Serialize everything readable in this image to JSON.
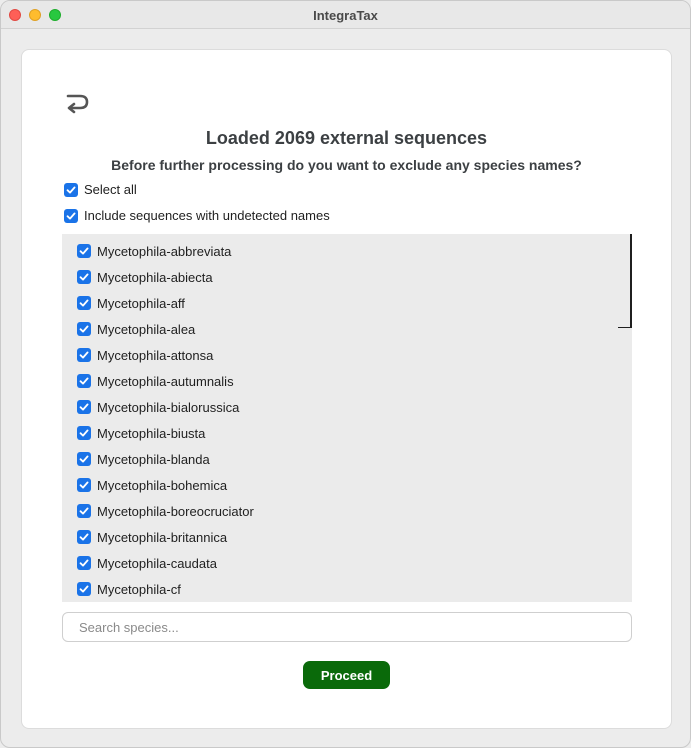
{
  "window": {
    "title": "IntegraTax"
  },
  "header": {
    "heading": "Loaded 2069 external sequences",
    "subheading": "Before further processing do you want to exclude any species names?"
  },
  "options": {
    "select_all": {
      "label": "Select all",
      "checked": true
    },
    "include_undetected": {
      "label": "Include sequences with undetected names",
      "checked": true
    }
  },
  "species": [
    {
      "label": "Mycetophila-abbreviata",
      "checked": true
    },
    {
      "label": "Mycetophila-abiecta",
      "checked": true
    },
    {
      "label": "Mycetophila-aff",
      "checked": true
    },
    {
      "label": "Mycetophila-alea",
      "checked": true
    },
    {
      "label": "Mycetophila-attonsa",
      "checked": true
    },
    {
      "label": "Mycetophila-autumnalis",
      "checked": true
    },
    {
      "label": "Mycetophila-bialorussica",
      "checked": true
    },
    {
      "label": "Mycetophila-biusta",
      "checked": true
    },
    {
      "label": "Mycetophila-blanda",
      "checked": true
    },
    {
      "label": "Mycetophila-bohemica",
      "checked": true
    },
    {
      "label": "Mycetophila-boreocruciator",
      "checked": true
    },
    {
      "label": "Mycetophila-britannica",
      "checked": true
    },
    {
      "label": "Mycetophila-caudata",
      "checked": true
    },
    {
      "label": "Mycetophila-cf",
      "checked": true
    }
  ],
  "search": {
    "placeholder": "Search species...",
    "value": ""
  },
  "actions": {
    "proceed_label": "Proceed"
  },
  "colors": {
    "checkbox_accent": "#1a73e8",
    "proceed_bg": "#0a6a0a",
    "list_bg": "#ebebeb"
  },
  "icons": {
    "back": "undo-arrow-icon",
    "check": "checkmark-icon"
  }
}
